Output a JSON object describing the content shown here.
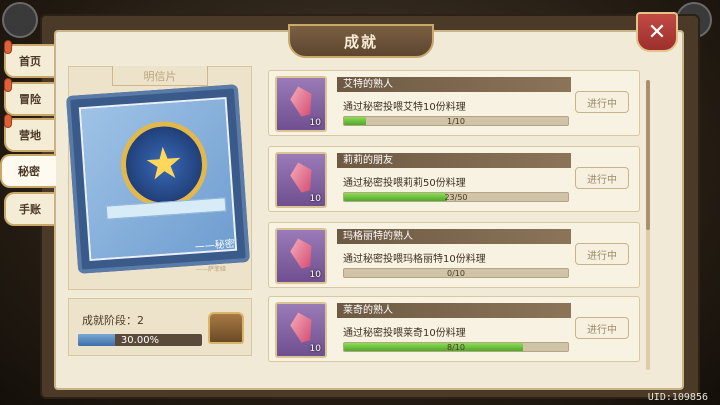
{
  "title": "成就",
  "close_icon": "close-icon",
  "uid": "UID:109856",
  "side_tabs": [
    {
      "label": "首页",
      "pinned": true
    },
    {
      "label": "冒险",
      "pinned": true
    },
    {
      "label": "营地",
      "pinned": true
    },
    {
      "label": "秘密",
      "active": true
    },
    {
      "label": "手账"
    }
  ],
  "postcard": {
    "label": "明信片",
    "stamp_caption": "——秘密",
    "signature": "——萨菲娅"
  },
  "stage": {
    "label": "成就阶段：2",
    "percent_text": "30.00%",
    "progress": 0.3,
    "chest_icon": "treasure-chest-icon"
  },
  "achievements": [
    {
      "title": "艾特的熟人",
      "desc": "通过秘密投喂艾特10份料理",
      "count": "10",
      "progress_text": "1/10",
      "progress": 0.1,
      "status": "进行中",
      "icon": "pink-gem-icon"
    },
    {
      "title": "莉莉的朋友",
      "desc": "通过秘密投喂莉莉50份料理",
      "count": "10",
      "progress_text": "23/50",
      "progress": 0.46,
      "status": "进行中",
      "icon": "pink-gem-icon"
    },
    {
      "title": "玛格丽特的熟人",
      "desc": "通过秘密投喂玛格丽特10份料理",
      "count": "10",
      "progress_text": "0/10",
      "progress": 0.0,
      "status": "进行中",
      "icon": "pink-gem-icon"
    },
    {
      "title": "莱奇的熟人",
      "desc": "通过秘密投喂莱奇10份料理",
      "count": "10",
      "progress_text": "8/10",
      "progress": 0.8,
      "status": "进行中",
      "icon": "pink-gem-icon"
    }
  ]
}
